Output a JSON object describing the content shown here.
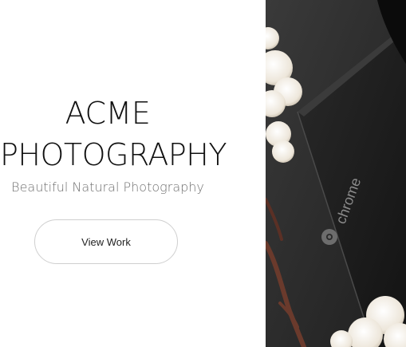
{
  "hero": {
    "title_line1": "ACME",
    "title_line2": "PHOTOGRAPHY",
    "subtitle": "Beautiful Natural Photography",
    "cta_label": "View Work"
  },
  "photo": {
    "device_brand_text": "chrome",
    "colors": {
      "background": "#2a2a2a",
      "device": "#1b1b1b",
      "cotton": "#f3efe8",
      "branch": "#6a3a2c"
    }
  }
}
